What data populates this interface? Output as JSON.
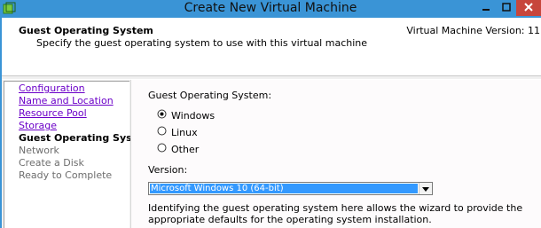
{
  "window": {
    "title": "Create New Virtual Machine"
  },
  "header": {
    "title": "Guest Operating System",
    "subtitle": "Specify the guest operating system to use with this virtual machine",
    "version": "Virtual Machine Version: 11"
  },
  "nav": {
    "items": [
      {
        "label": "Configuration",
        "state": "completed"
      },
      {
        "label": "Name and Location",
        "state": "completed"
      },
      {
        "label": "Resource Pool",
        "state": "completed"
      },
      {
        "label": "Storage",
        "state": "completed"
      },
      {
        "label": "Guest Operating System",
        "state": "current"
      },
      {
        "label": "Network",
        "state": "pending"
      },
      {
        "label": "Create a Disk",
        "state": "pending"
      },
      {
        "label": "Ready to Complete",
        "state": "pending"
      }
    ]
  },
  "form": {
    "guest_os_label": "Guest Operating System:",
    "options": [
      {
        "label": "Windows",
        "selected": true
      },
      {
        "label": "Linux",
        "selected": false
      },
      {
        "label": "Other",
        "selected": false
      }
    ],
    "version_label": "Version:",
    "version_value": "Microsoft Windows 10 (64-bit)",
    "description": "Identifying the guest operating system here allows the wizard to provide the appropriate defaults for the operating system installation."
  },
  "colors": {
    "titlebar": "#3a94d6",
    "close_button": "#c7463c",
    "link": "#6b00c8",
    "selection": "#3399ff"
  }
}
